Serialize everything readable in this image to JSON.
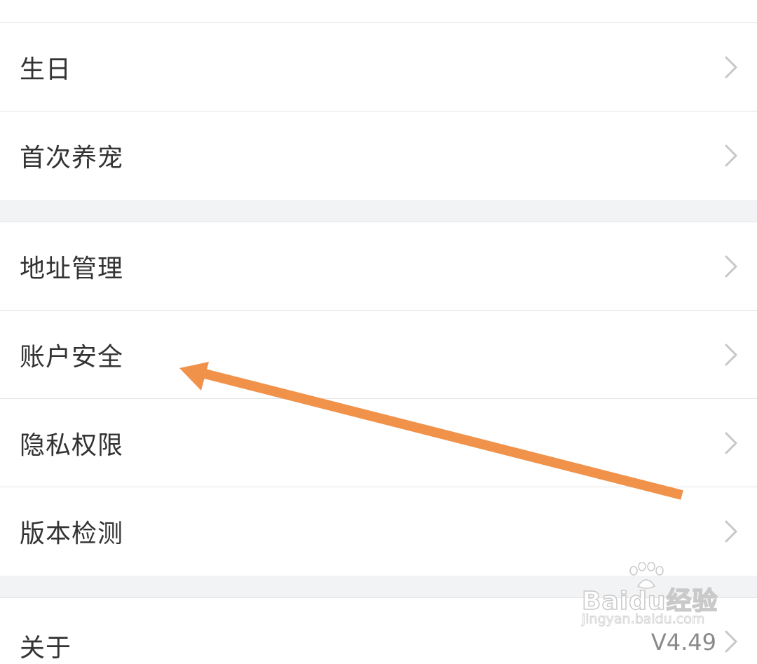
{
  "settings": {
    "group1": [
      {
        "label": "生日"
      },
      {
        "label": "首次养宠"
      }
    ],
    "group2": [
      {
        "label": "地址管理"
      },
      {
        "label": "账户安全"
      },
      {
        "label": "隐私权限"
      },
      {
        "label": "版本检测"
      }
    ],
    "group3": [
      {
        "label": "关于",
        "value": "V4.49"
      }
    ]
  },
  "colors": {
    "row_text": "#333333",
    "secondary_text": "#8a8a8a",
    "chevron": "#c7c7cc",
    "section_gap": "#f2f3f5",
    "divider": "#e3e3e3",
    "annotation_arrow": "#f0924a"
  },
  "icons": {
    "row_chevron": "chevron-right-icon",
    "watermark_logo": "baidu-paw-icon"
  },
  "watermark": {
    "brand": "Baidu经验",
    "url": "jingyan.baidu.com"
  }
}
